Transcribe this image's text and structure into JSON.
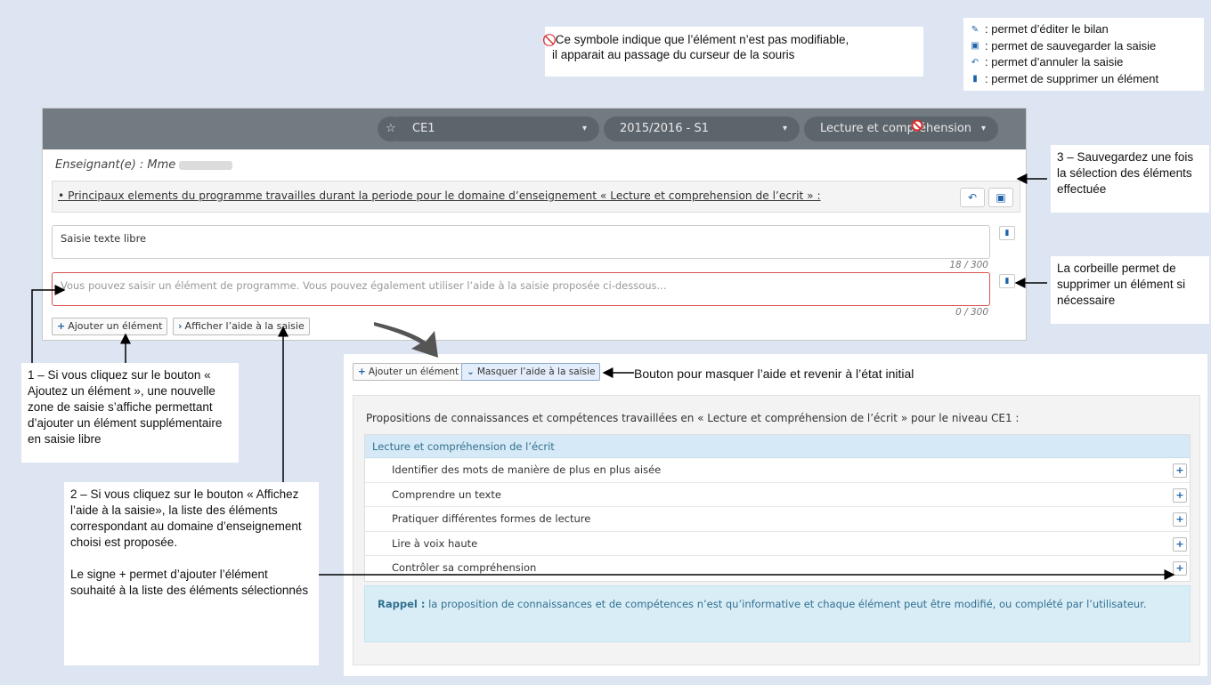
{
  "note_box": {
    "symbol": "⃠",
    "line1": "Ce symbole indique que l’élément n’est pas modifiable,",
    "line2": "il apparait au passage du curseur de la souris"
  },
  "legend": [
    {
      "icon": "pencil-icon",
      "glyph": "✎",
      "text": ": permet d’éditer le bilan"
    },
    {
      "icon": "floppy-icon",
      "glyph": "▣",
      "text": ": permet de sauvegarder la saisie"
    },
    {
      "icon": "undo-icon",
      "glyph": "↶",
      "text": ": permet d’annuler la saisie"
    },
    {
      "icon": "trash-icon",
      "glyph": "▮",
      "text": ": permet de supprimer un élément"
    }
  ],
  "toolbar": {
    "star": "☆",
    "level": "CE1",
    "period": "2015/2016 - S1",
    "domain": "Lecture et compréhension",
    "caret": "▾"
  },
  "teacher_label": "Enseignant(e) : Mme",
  "section": {
    "title": "• Principaux elements du programme travailles durant la periode pour le domaine d’enseignement « Lecture et comprehension de l’ecrit » :",
    "undo_glyph": "↶",
    "save_glyph": "▣"
  },
  "field1": {
    "value": "Saisie texte libre",
    "counter": "18 / 300"
  },
  "field2": {
    "placeholder": "Vous pouvez saisir un élément de programme. Vous pouvez également utiliser l’aide à la saisie proposée ci-dessous...",
    "counter": "0 / 300"
  },
  "buttons": {
    "add_label": "Ajouter un élément",
    "show_help_label": "Afficher l’aide à la saisie",
    "hide_help_label": "Masquer l’aide à la saisie"
  },
  "callouts": {
    "step3": "3 – Sauvegardez une fois la sélection des éléments effectuée",
    "trash": "La corbeille permet de supprimer un élément si nécessaire",
    "step1": "1 – Si vous cliquez sur le bouton « Ajoutez un élément », une nouvelle zone de saisie s’affiche permettant d’ajouter un élément supplémentaire en saisie libre",
    "step2_a": "2 – Si vous cliquez sur le bouton « Affichez l’aide à la saisie», la liste des éléments correspondant au domaine d’enseignement choisi est proposée.",
    "step2_b": "Le signe + permet d’ajouter l’élément souhaité à la liste des éléments sélectionnés",
    "lower_hint": "Bouton pour masquer l’aide et revenir à l’état initial"
  },
  "help": {
    "intro": "Propositions de connaissances et compétences travaillées en « Lecture et compréhension de l’écrit » pour le niveau CE1 :",
    "category": "Lecture et compréhension de l’écrit",
    "items": [
      "Identifier des mots de manière de plus en plus aisée",
      "Comprendre un texte",
      "Pratiquer différentes formes de lecture",
      "Lire à voix haute",
      "Contrôler sa compréhension"
    ],
    "rappel_label": "Rappel :",
    "rappel_text": "la proposition de connaissances et de compétences n’est qu’informative et chaque élément peut être modifié, ou complété par l’utilisateur."
  },
  "colors": {
    "background": "#dde4f2",
    "toolbar": "#737b82",
    "accent": "#1e63a8",
    "error": "#d9534f",
    "info_bg": "#d9edf7"
  }
}
